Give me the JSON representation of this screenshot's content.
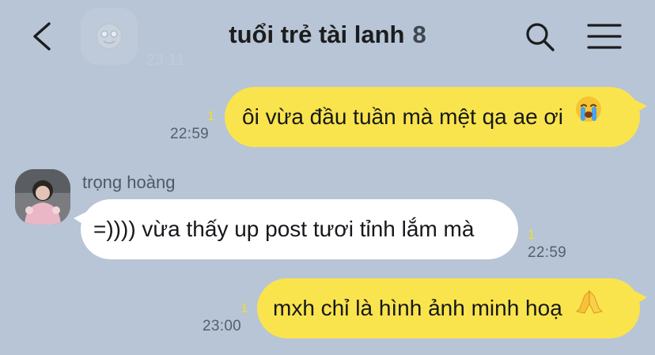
{
  "header": {
    "title": "tuổi trẻ tài lanh",
    "member_count": "8",
    "prev_message_time": "23:11"
  },
  "messages": [
    {
      "side": "mine",
      "text": "ôi vừa đầu tuần mà mệt qa ae ơi",
      "emoji": "crying-face-icon",
      "time": "22:59",
      "unread": "1"
    },
    {
      "side": "theirs",
      "sender": "trọng hoàng",
      "text": "=)))) vừa thấy up post tươi tỉnh lắm mà",
      "time": "22:59",
      "unread": "1"
    },
    {
      "side": "mine",
      "text": "mxh chỉ là hình ảnh minh hoạ",
      "emoji": "folded-hands-icon",
      "time": "23:00",
      "unread": "1"
    }
  ],
  "colors": {
    "background": "#b7c5d6",
    "my_bubble": "#fae44d",
    "their_bubble": "#ffffff",
    "unread_count": "#f5dc2a"
  }
}
